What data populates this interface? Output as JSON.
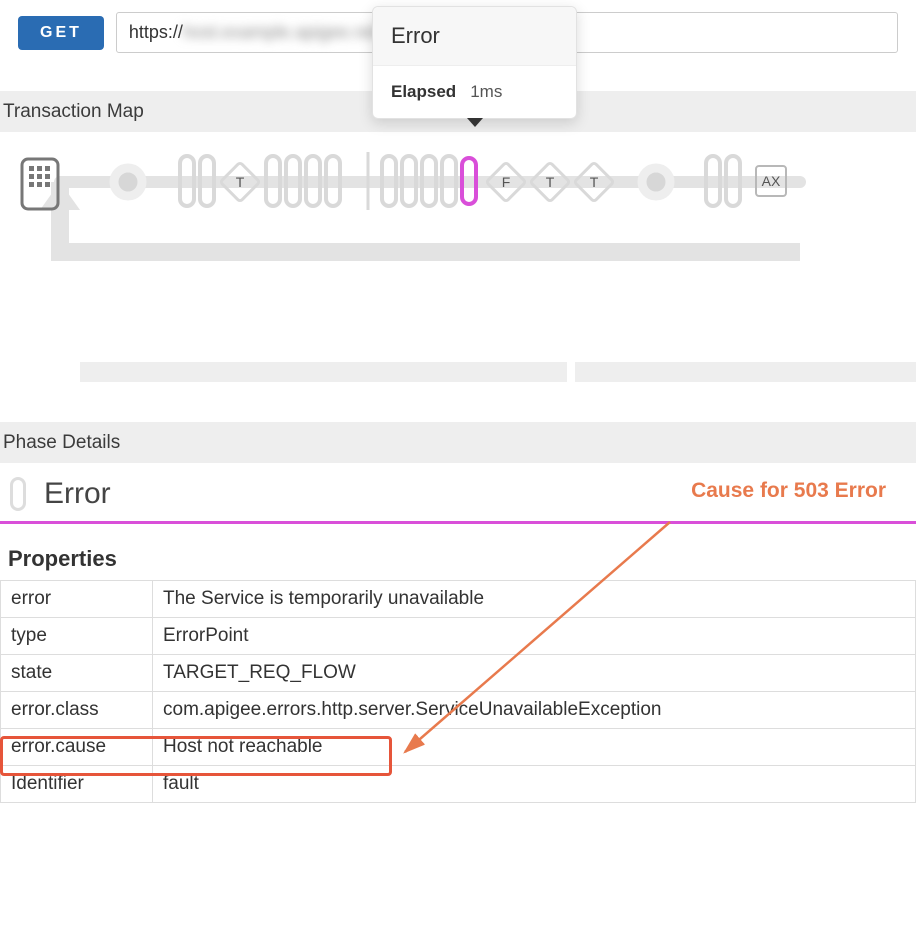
{
  "request": {
    "method": "GET",
    "url_prefix": "https://",
    "url_blurred": "host.example.apigee.net / path / resource"
  },
  "popup": {
    "title": "Error",
    "elapsed_label": "Elapsed",
    "elapsed_value": "1ms"
  },
  "transaction_map": {
    "title": "Transaction Map",
    "nodes": [
      {
        "label": "",
        "kind": "device"
      },
      {
        "label": "",
        "kind": "dot"
      },
      {
        "label": "",
        "kind": "pill"
      },
      {
        "label": "",
        "kind": "pill"
      },
      {
        "label": "T",
        "kind": "diamond"
      },
      {
        "label": "",
        "kind": "pill"
      },
      {
        "label": "",
        "kind": "pill"
      },
      {
        "label": "",
        "kind": "pill"
      },
      {
        "label": "",
        "kind": "pill"
      },
      {
        "label": "",
        "kind": "pill"
      },
      {
        "label": "",
        "kind": "pill"
      },
      {
        "label": "",
        "kind": "pill"
      },
      {
        "label": "",
        "kind": "pill"
      },
      {
        "label": "",
        "kind": "pill-error"
      },
      {
        "label": "F",
        "kind": "diamond"
      },
      {
        "label": "T",
        "kind": "diamond"
      },
      {
        "label": "T",
        "kind": "diamond"
      },
      {
        "label": "",
        "kind": "dot"
      },
      {
        "label": "",
        "kind": "pill"
      },
      {
        "label": "",
        "kind": "pill"
      },
      {
        "label": "AX",
        "kind": "box"
      }
    ]
  },
  "phase_details": {
    "section_title": "Phase Details",
    "phase_name": "Error",
    "annotation": "Cause for 503 Error"
  },
  "properties": {
    "title": "Properties",
    "rows": [
      {
        "k": "error",
        "v": "The Service is temporarily unavailable"
      },
      {
        "k": "type",
        "v": "ErrorPoint"
      },
      {
        "k": "state",
        "v": "TARGET_REQ_FLOW"
      },
      {
        "k": "error.class",
        "v": "com.apigee.errors.http.server.ServiceUnavailableException"
      },
      {
        "k": "error.cause",
        "v": "Host not reachable"
      },
      {
        "k": "Identifier",
        "v": "fault"
      }
    ]
  }
}
